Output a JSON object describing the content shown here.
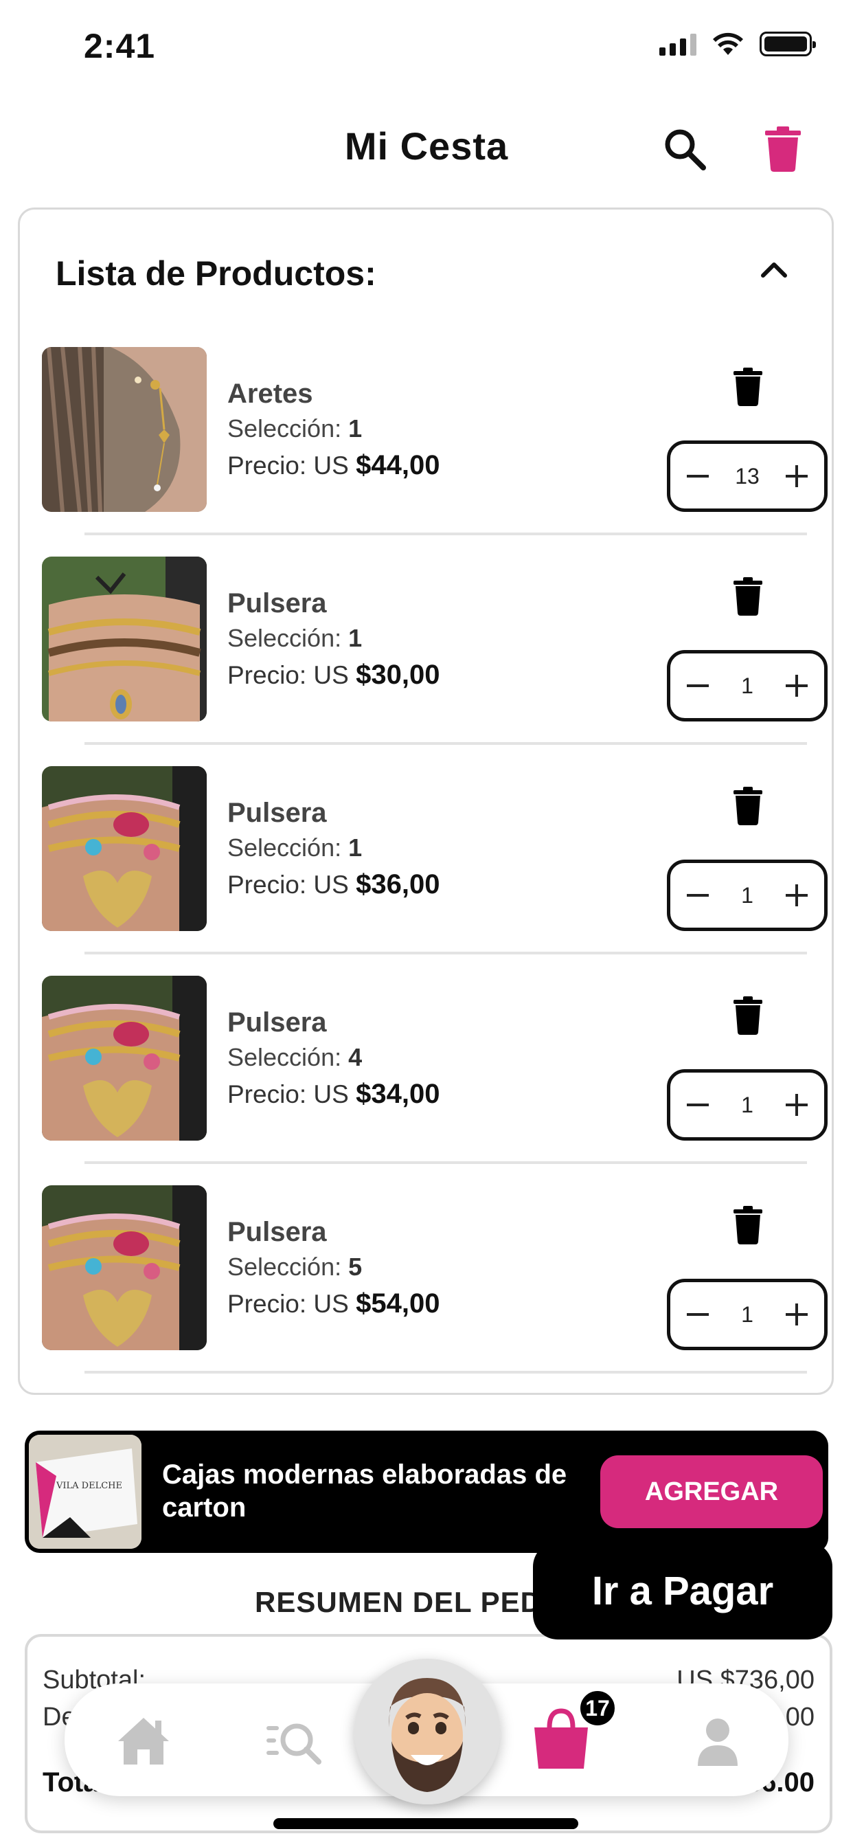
{
  "status": {
    "time": "2:41"
  },
  "header": {
    "title": "Mi Cesta"
  },
  "products_panel": {
    "title": "Lista de Productos:",
    "selection_label": "Selección:",
    "price_label": "Precio: US",
    "items": [
      {
        "name": "Aretes",
        "selection": "1",
        "price": "$44,00",
        "quantity": "13"
      },
      {
        "name": "Pulsera",
        "selection": "1",
        "price": "$30,00",
        "quantity": "1"
      },
      {
        "name": "Pulsera",
        "selection": "1",
        "price": "$36,00",
        "quantity": "1"
      },
      {
        "name": "Pulsera",
        "selection": "4",
        "price": "$34,00",
        "quantity": "1"
      },
      {
        "name": "Pulsera",
        "selection": "5",
        "price": "$54,00",
        "quantity": "1"
      }
    ]
  },
  "promo": {
    "text": "Cajas modernas elaboradas de carton",
    "button_label": "AGREGAR",
    "image_logo_text": "VILA DELCHE"
  },
  "pay_button": {
    "label": "Ir a Pagar"
  },
  "summary": {
    "title": "RESUMEN DEL PED",
    "subtotal_label": "Subtotal:",
    "subtotal_value": "US $736,00",
    "discount_label": "De",
    "discount_value": ".00",
    "total_label": "Tota",
    "total_value": "US $536.00"
  },
  "tabbar": {
    "cart_badge": "17"
  },
  "colors": {
    "accent": "#d62a7d",
    "dark": "#000000",
    "border": "#d9d9d9"
  }
}
